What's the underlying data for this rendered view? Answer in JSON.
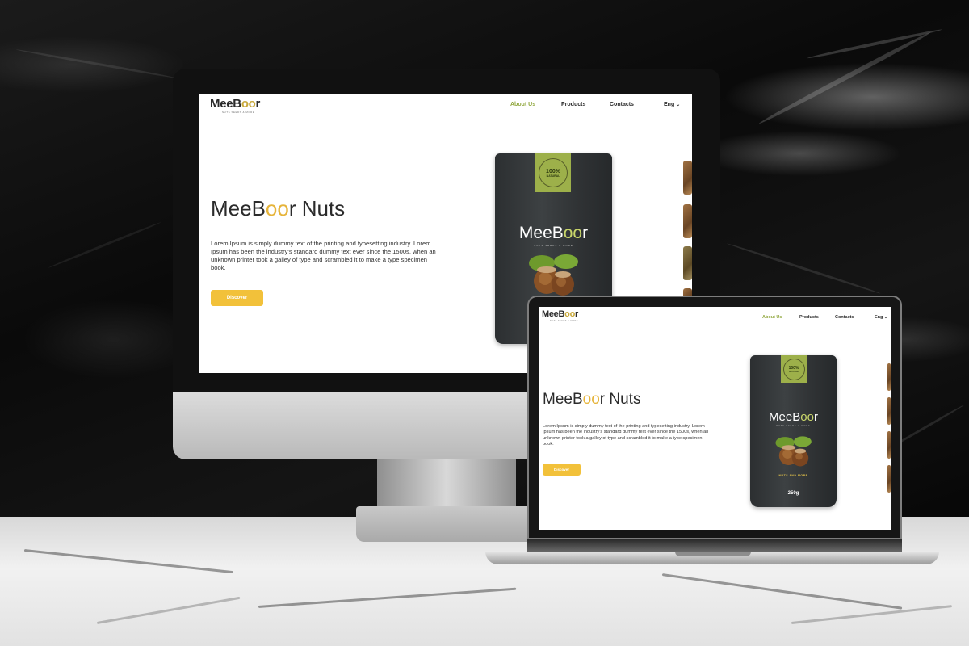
{
  "site": {
    "logo_main": "MeeB",
    "logo_accent": "oo",
    "logo_end": "r",
    "tagline": "NUTS SEEDS & MORE",
    "nav": [
      {
        "label": "About Us",
        "active": true
      },
      {
        "label": "Products",
        "active": false
      },
      {
        "label": "Contacts",
        "active": false
      }
    ],
    "language": "Eng",
    "hero": {
      "title_part1": "MeeB",
      "title_accent": "oo",
      "title_part2": "r Nuts",
      "body": "Lorem Ipsum is simply dummy text of the printing and typesetting industry. Lorem Ipsum has been the industry's standard dummy text ever since the 1500s, when an unknown printer took a galley of type and scrambled it to make a type specimen book.",
      "cta": "Discover"
    },
    "product": {
      "badge_top": "100%",
      "badge_bottom": "NATURAL",
      "brand_main": "MeeB",
      "brand_accent": "oo",
      "brand_end": "r",
      "brand_sub": "NUTS SEEDS & MORE",
      "caption": "NUTS AND MORE",
      "weight": "250g"
    }
  },
  "colors": {
    "accent_green": "#8fa63b",
    "accent_yellow": "#f2c13a",
    "text_dark": "#2b2b2b",
    "pouch_dark": "#34383a",
    "badge_green": "#9db04a"
  }
}
